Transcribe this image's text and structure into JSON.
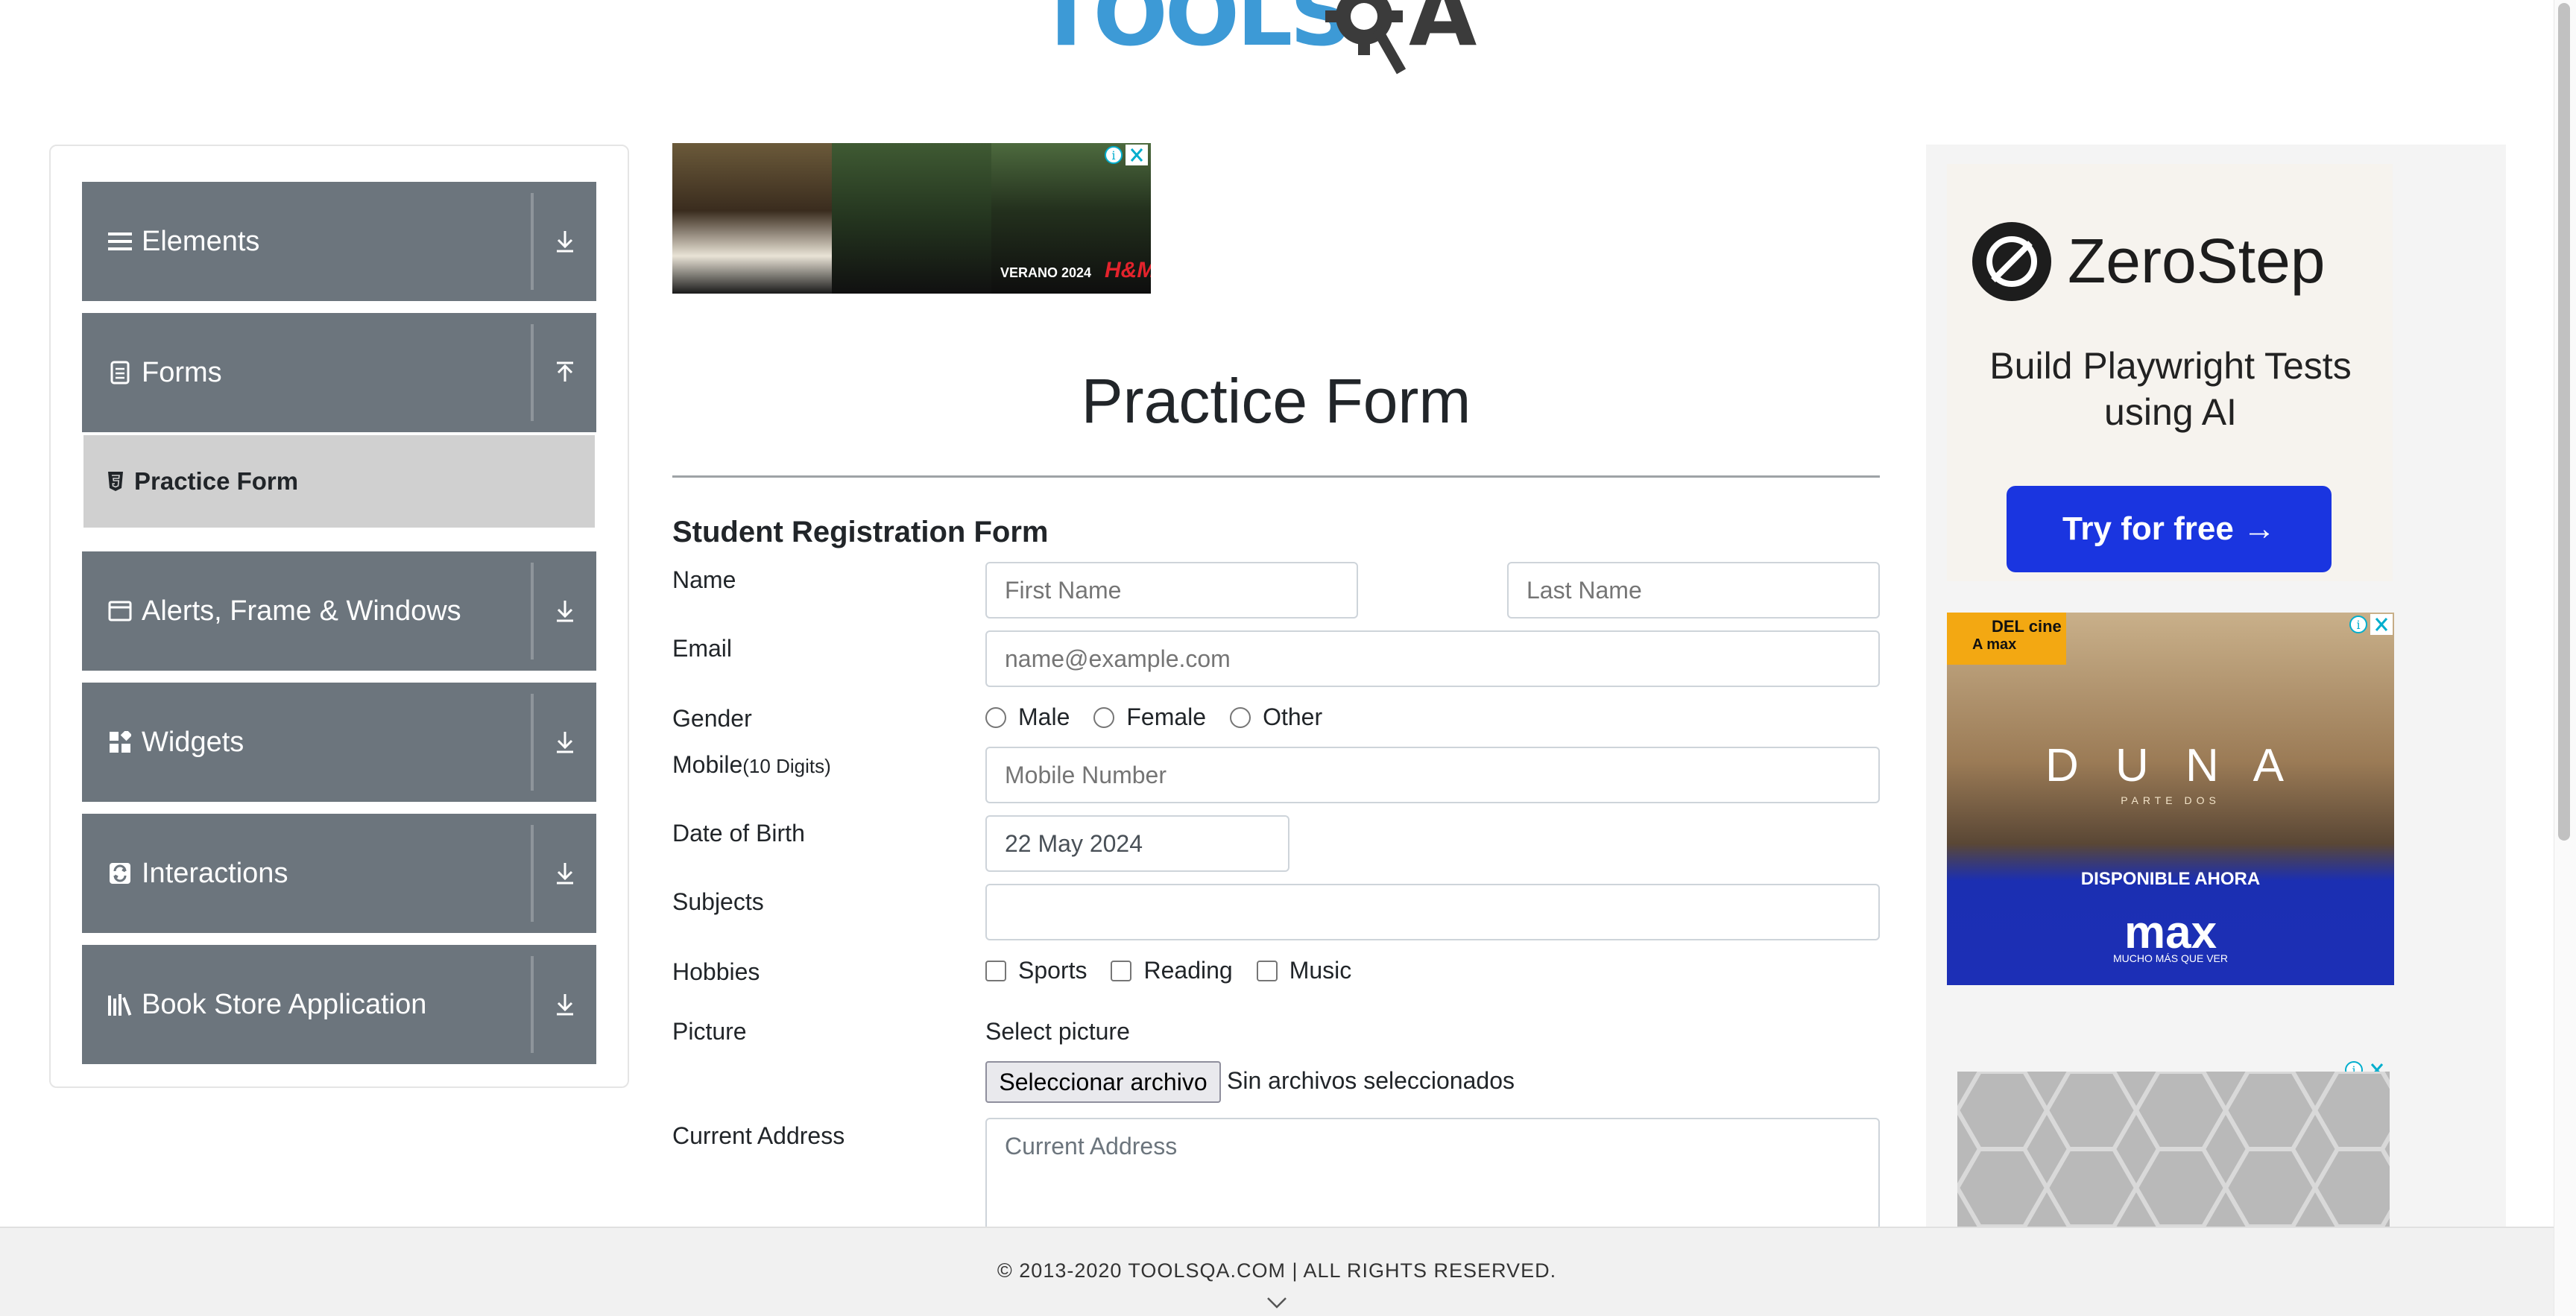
{
  "header": {
    "logo_text": "TOOLSQA"
  },
  "sidebar": {
    "groups": [
      {
        "label": "Elements",
        "icon": "menu-lines-icon",
        "arrow": "download-arrow-icon"
      },
      {
        "label": "Forms",
        "icon": "document-icon",
        "arrow": "upload-arrow-icon",
        "expanded": true
      },
      {
        "label": "Alerts, Frame & Windows",
        "icon": "window-icon",
        "arrow": "download-arrow-icon"
      },
      {
        "label": "Widgets",
        "icon": "widgets-icon",
        "arrow": "download-arrow-icon"
      },
      {
        "label": "Interactions",
        "icon": "interactions-icon",
        "arrow": "download-arrow-icon"
      },
      {
        "label": "Book Store Application",
        "icon": "books-icon",
        "arrow": "download-arrow-icon"
      }
    ],
    "forms_items": [
      {
        "label": "Practice Form",
        "icon": "html5-icon",
        "active": true
      }
    ]
  },
  "ads": {
    "top": {
      "caption": "VERANO 2024",
      "brand": "H&M"
    },
    "zerostep": {
      "brand": "ZeroStep",
      "headline": "Build Playwright Tests using AI",
      "cta": "Try for free →",
      "cta_color": "#1a35e0"
    },
    "dune": {
      "badge_top": "DEL cine",
      "badge_bottom": "A max",
      "title": "D U N A",
      "subtitle": "PARTE DOS",
      "tagline": "DISPONIBLE AHORA",
      "logo": "max",
      "logo_sub": "MUCHO MÁS QUE VER"
    }
  },
  "main": {
    "title": "Practice Form",
    "form_heading": "Student Registration Form",
    "name": {
      "label": "Name",
      "first_placeholder": "First Name",
      "last_placeholder": "Last Name"
    },
    "email": {
      "label": "Email",
      "placeholder": "name@example.com"
    },
    "gender": {
      "label": "Gender",
      "options": [
        "Male",
        "Female",
        "Other"
      ]
    },
    "mobile": {
      "label": "Mobile",
      "hint": "(10 Digits)",
      "placeholder": "Mobile Number"
    },
    "dob": {
      "label": "Date of Birth",
      "value": "22 May 2024"
    },
    "subjects": {
      "label": "Subjects",
      "value": ""
    },
    "hobbies": {
      "label": "Hobbies",
      "options": [
        "Sports",
        "Reading",
        "Music"
      ]
    },
    "picture": {
      "label": "Picture",
      "select_label": "Select picture",
      "button": "Seleccionar archivo",
      "status": "Sin archivos seleccionados"
    },
    "address": {
      "label": "Current Address",
      "placeholder": "Current Address"
    }
  },
  "footer": {
    "text": "© 2013-2020 TOOLSQA.COM | ALL RIGHTS RESERVED."
  },
  "colors": {
    "sidebar_header": "#6c757d",
    "active_item": "#d0d0d0",
    "logo_blue": "#3d9ad6",
    "logo_dark": "#3b3b3b"
  }
}
